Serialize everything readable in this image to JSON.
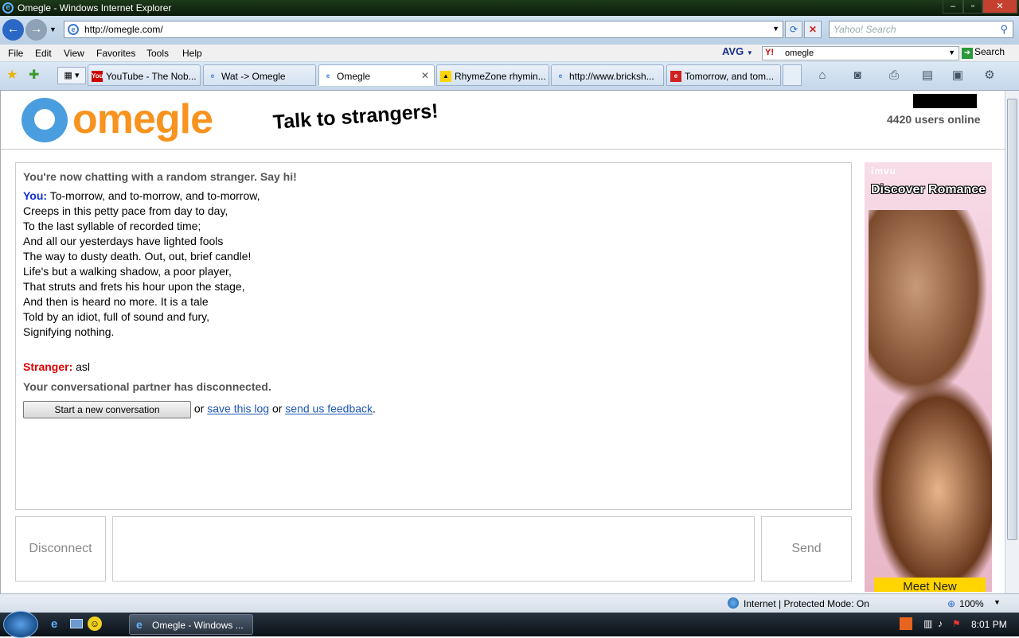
{
  "window": {
    "title": "Omegle - Windows Internet Explorer"
  },
  "address": {
    "url": "http://omegle.com/",
    "search_placeholder": "Yahoo! Search"
  },
  "menu": [
    "File",
    "Edit",
    "View",
    "Favorites",
    "Tools",
    "Help"
  ],
  "toolbar": {
    "avg_label": "AVG",
    "yahoo_query": "omegle",
    "search_label": "Search"
  },
  "tabs": [
    {
      "label": "YouTube - The Nob...",
      "icon": "youtube-icon"
    },
    {
      "label": "Wat -> Omegle",
      "icon": "ie-page-icon"
    },
    {
      "label": "Omegle",
      "icon": "ie-page-icon",
      "active": true
    },
    {
      "label": "RhymeZone rhymin...",
      "icon": "rhymezone-icon"
    },
    {
      "label": "http://www.bricksh...",
      "icon": "ie-page-icon"
    },
    {
      "label": "Tomorrow, and tom...",
      "icon": "enotes-icon"
    }
  ],
  "page": {
    "logo_text": "omegle",
    "tagline": "Talk to strangers!",
    "users_online": "4420 users online",
    "chat": {
      "intro": "You're now chatting with a random stranger. Say hi!",
      "you_label": "You:",
      "you_lines": [
        "To-morrow, and to-morrow, and to-morrow,",
        "Creeps in this petty pace from day to day,",
        "To the last syllable of recorded time;",
        "And all our yesterdays have lighted fools",
        "The way to dusty death. Out, out, brief candle!",
        "Life's but a walking shadow, a poor player,",
        "That struts and frets his hour upon the stage,",
        "And then is heard no more. It is a tale",
        "Told by an idiot, full of sound and fury,",
        "Signifying nothing."
      ],
      "stranger_label": "Stranger:",
      "stranger_msg": "asl",
      "disconnected": "Your conversational partner has disconnected.",
      "new_conv_button": "Start a new conversation",
      "or1": "or",
      "save_log": "save this log",
      "or2": "or",
      "feedback": "send us feedback",
      "period": "."
    },
    "disconnect_button": "Disconnect",
    "send_button": "Send",
    "ad": {
      "brand": "imvu",
      "headline": "Discover Romance",
      "cta": "Meet New"
    }
  },
  "status": {
    "zone": "Internet | Protected Mode: On",
    "zoom": "100%"
  },
  "taskbar": {
    "task_label": "Omegle - Windows ...",
    "clock": "8:01 PM"
  }
}
